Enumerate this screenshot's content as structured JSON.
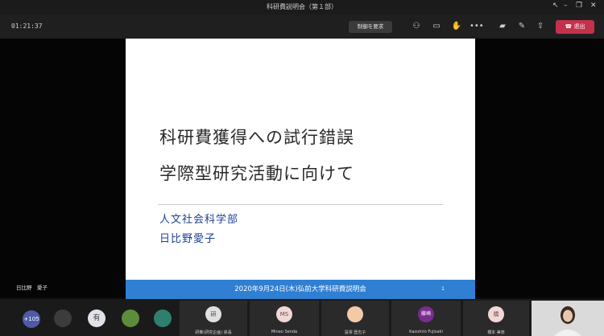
{
  "window": {
    "title": "科研費説明会（第１部）"
  },
  "toolbar": {
    "timer": "01:21:37",
    "control_request_label": "制御を要求",
    "leave_label": "退出"
  },
  "slide": {
    "title_line1": "科研費獲得への試行錯誤",
    "title_line2": "学際型研究活動に向けて",
    "affiliation": "人文社会科学部",
    "presenter_name": "日比野愛子",
    "footer": "2020年9月24日(木)弘前大学科研費説明会",
    "page_number": "1"
  },
  "presenter_label": "日比野　愛子",
  "participants": {
    "overflow_count": "+105",
    "small_avatars": [
      {
        "initial": "",
        "color": "#3c3c3c"
      },
      {
        "initial": "有",
        "color": "#dfe3e8"
      },
      {
        "initial": "",
        "color": "#5c8c3c"
      },
      {
        "initial": "",
        "color": "#2f7f6f"
      }
    ],
    "tiles": [
      {
        "initial": "研",
        "name": "研推(研究企画) 係長",
        "color": "#e0e0e0"
      },
      {
        "initial": "MS",
        "name": "Mineo Senda",
        "color": "#f2d7d5"
      },
      {
        "initial": "",
        "name": "冨澤 登志子",
        "color": "#f4c9a6"
      },
      {
        "initial": "藤崎",
        "name": "Kazuhiro Fujisaki",
        "color": "#7b2c8f"
      },
      {
        "initial": "橋",
        "name": "橋本 美奈",
        "color": "#f2d7d5"
      }
    ]
  },
  "colors": {
    "slide_footer": "#2f7fd2",
    "slide_text_blue": "#1f3f93",
    "leave_button": "#c4314b"
  }
}
